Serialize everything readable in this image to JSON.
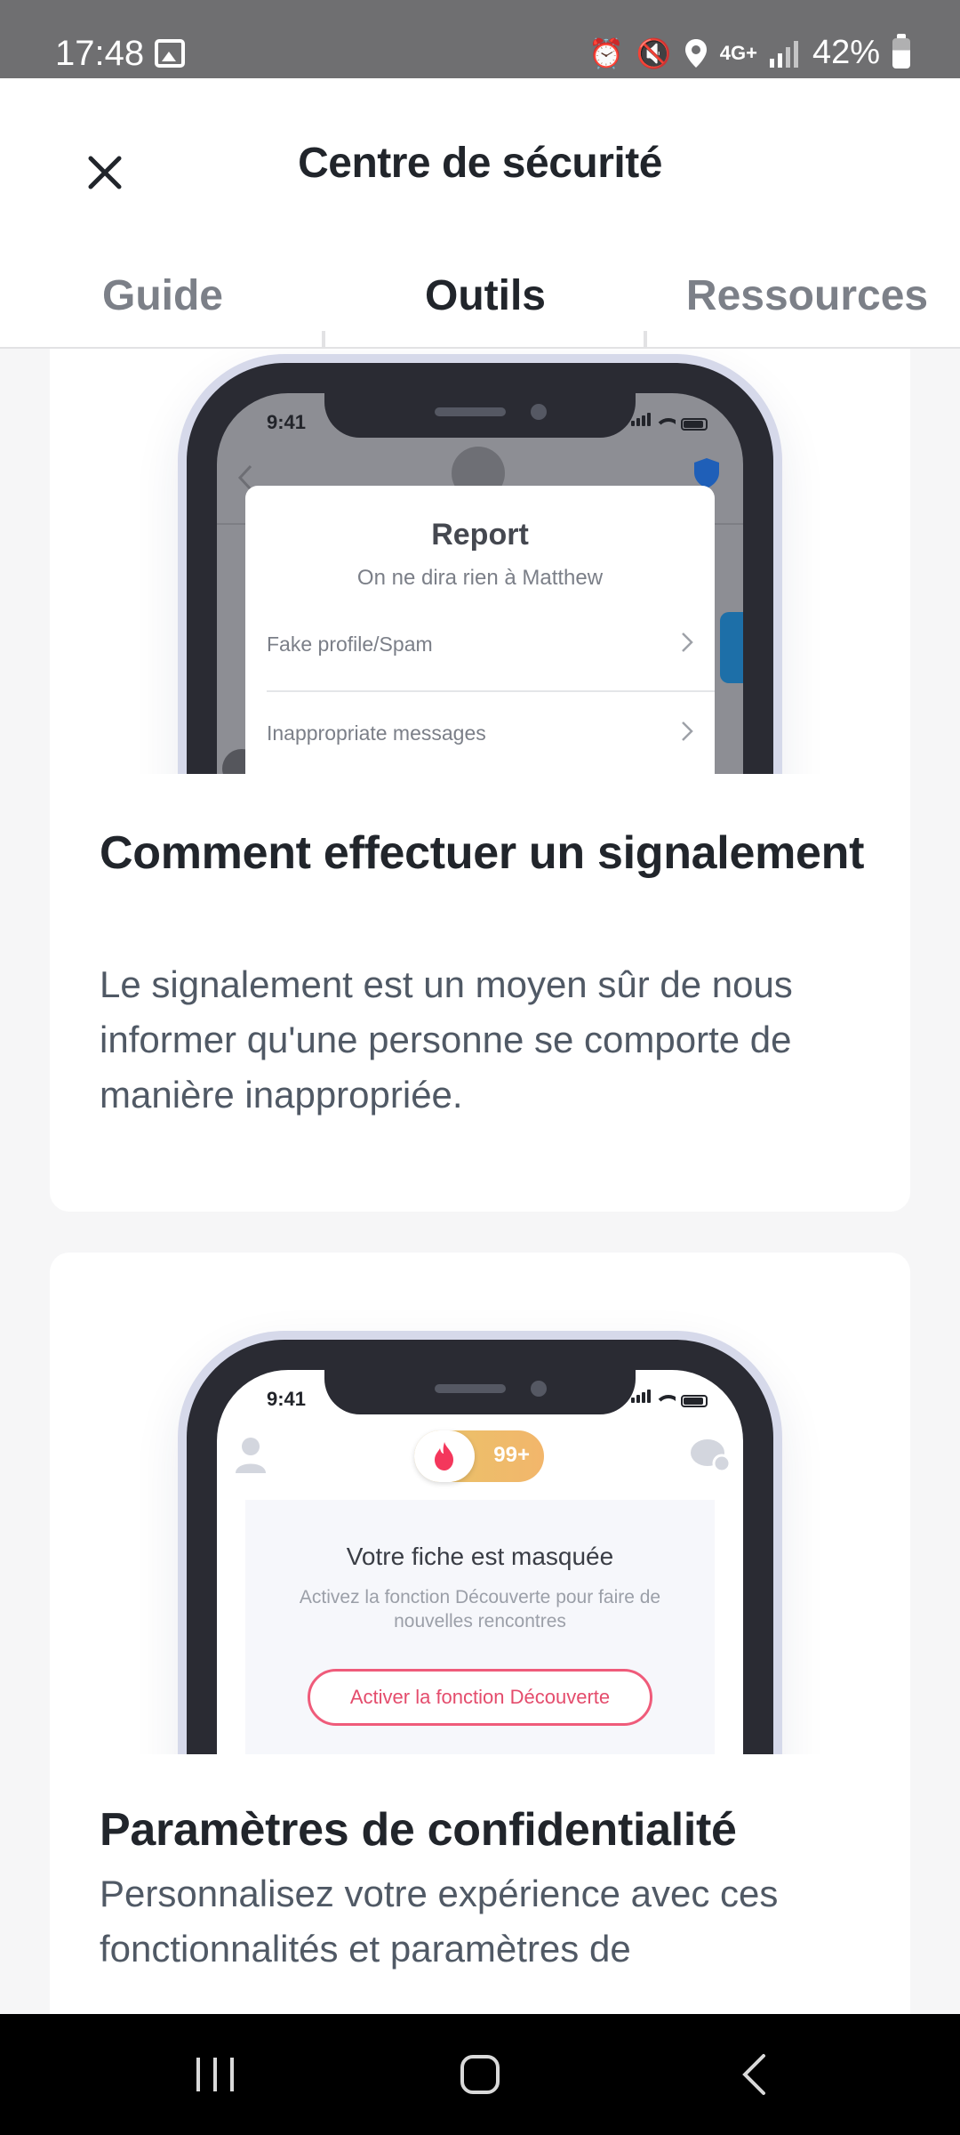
{
  "status_bar": {
    "time": "17:48",
    "network": "4G+",
    "battery": "42%"
  },
  "header": {
    "title": "Centre de sécurité",
    "tabs": [
      {
        "label": "Guide",
        "active": false
      },
      {
        "label": "Outils",
        "active": true
      },
      {
        "label": "Ressources",
        "active": false
      }
    ]
  },
  "cards": [
    {
      "heading": "Comment effectuer un signalement",
      "description": "Le signalement est un moyen sûr de nous informer qu'une personne se comporte de manière inappropriée.",
      "illustration": {
        "phone_time": "9:41",
        "modal_title": "Report",
        "modal_subtitle": "On ne dira rien à Matthew",
        "options": [
          "Fake profile/Spam",
          "Inappropriate messages"
        ]
      }
    },
    {
      "heading": "Paramètres de confidentialité",
      "description": "Personnalisez votre expérience avec ces fonctionnalités et paramètres de",
      "illustration": {
        "phone_time": "9:41",
        "badge_count": "99+",
        "panel_title": "Votre fiche est masquée",
        "panel_subtitle": "Activez la fonction Découverte pour faire de nouvelles rencontres",
        "button_label": "Activer la fonction Découverte"
      }
    }
  ],
  "colors": {
    "status_bar_bg": "#6f6f71",
    "text_primary": "#21252b",
    "text_secondary": "#505965",
    "tab_inactive": "#7c8088",
    "accent_pink": "#ef5b7a",
    "accent_gold": "#e9c46a",
    "shield_blue": "#1f5fb8"
  },
  "icons": [
    "close-icon",
    "gallery-icon",
    "alarm-icon",
    "mute-icon",
    "location-icon",
    "signal-icon",
    "battery-icon",
    "recents-icon",
    "home-icon",
    "back-icon"
  ]
}
